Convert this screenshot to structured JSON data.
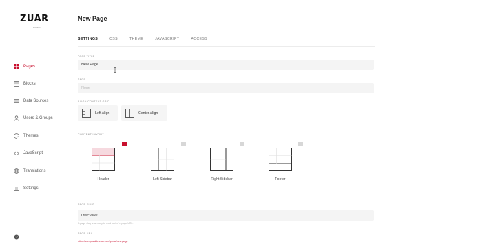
{
  "brand": {
    "name": "ZUAR",
    "sub": "ADMIN",
    "accent": "#c8102e"
  },
  "sidebar": {
    "items": [
      {
        "label": "Pages",
        "icon": "grid-icon",
        "active": true
      },
      {
        "label": "Blocks",
        "icon": "blocks-icon"
      },
      {
        "label": "Data Sources",
        "icon": "database-icon"
      },
      {
        "label": "Users & Groups",
        "icon": "user-icon"
      },
      {
        "label": "Themes",
        "icon": "palette-icon"
      },
      {
        "label": "JavaScript",
        "icon": "code-icon"
      },
      {
        "label": "Translations",
        "icon": "globe-icon"
      },
      {
        "label": "Settings",
        "icon": "settings-icon"
      }
    ],
    "help_icon": "help-icon"
  },
  "main": {
    "title": "New Page",
    "tabs": [
      {
        "label": "SETTINGS",
        "active": true
      },
      {
        "label": "CSS"
      },
      {
        "label": "THEME"
      },
      {
        "label": "JAVASCRIPT"
      },
      {
        "label": "ACCESS"
      }
    ]
  },
  "form": {
    "page_title": {
      "label": "PAGE TITLE",
      "value": "New Page"
    },
    "tags": {
      "label": "TAGS",
      "placeholder": "None"
    },
    "align": {
      "label": "ALIGN CONTENT GRID",
      "options": [
        {
          "label": "Left Align",
          "icon": "left-align-icon"
        },
        {
          "label": "Center Align",
          "icon": "center-align-icon"
        }
      ]
    },
    "layout": {
      "label": "CONTENT LAYOUT",
      "options": [
        {
          "label": "Header",
          "icon": "header-layout-icon",
          "checked": true
        },
        {
          "label": "Left Sidebar",
          "icon": "left-sidebar-layout-icon",
          "checked": false
        },
        {
          "label": "Right Sidebar",
          "icon": "right-sidebar-layout-icon",
          "checked": false
        },
        {
          "label": "Footer",
          "icon": "footer-layout-icon",
          "checked": false
        }
      ]
    },
    "slug": {
      "label": "PAGE SLUG",
      "value": "new-page",
      "hint": "A page slug is an easy to read part of a page URL."
    },
    "url": {
      "label": "PAGE URL",
      "value": "https://composable.zuar.com/portal/new-page"
    }
  }
}
